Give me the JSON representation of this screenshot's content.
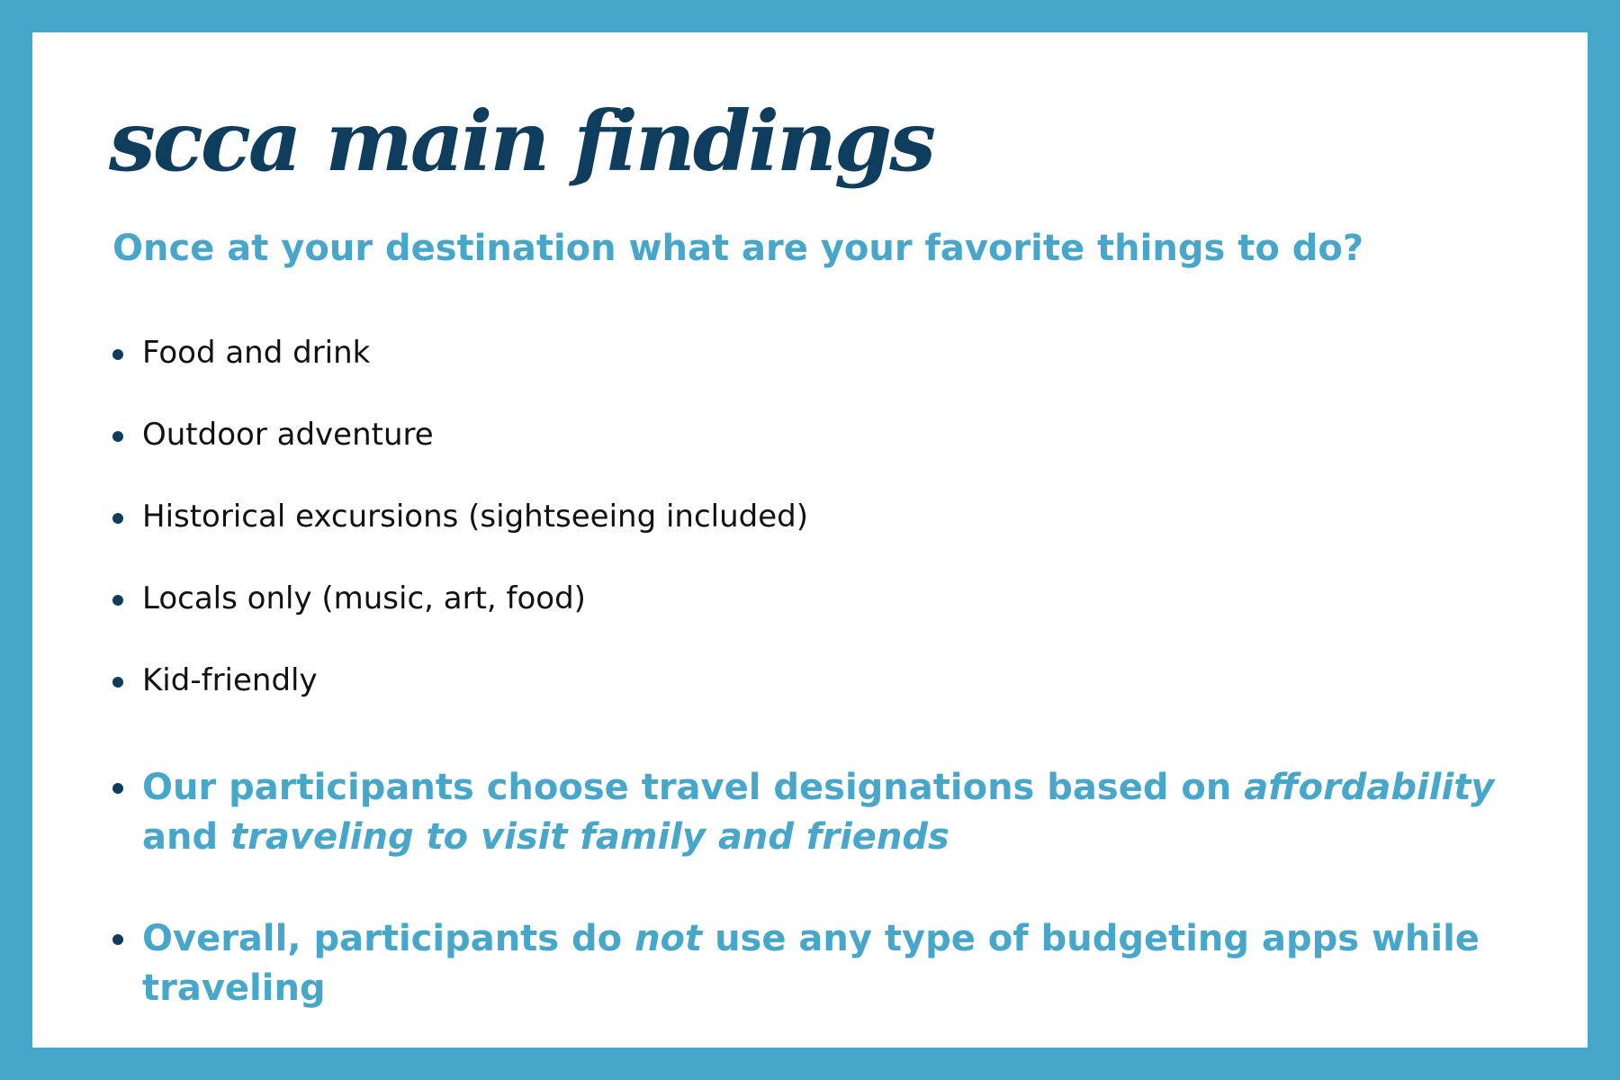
{
  "title": "scca main findings",
  "question": "Once at your destination what are your favorite things to do?",
  "activities": [
    "Food and drink",
    "Outdoor adventure",
    "Historical excursions (sightseeing included)",
    "Locals only (music, art, food)",
    "Kid-friendly"
  ],
  "findings": [
    {
      "part_1": "Our participants choose travel designations based on ",
      "emphasis_1": "affordability",
      "part_2": " and ",
      "emphasis_2": "traveling to visit family and friends"
    },
    {
      "part_1": "Overall, participants do ",
      "emphasis_1": "not",
      "part_2": " use any type of budgeting apps while traveling"
    }
  ],
  "colors": {
    "frame": "#47a7cb",
    "title": "#0e3d5e",
    "accent_text": "#47a7cb",
    "body_text": "#111111"
  }
}
